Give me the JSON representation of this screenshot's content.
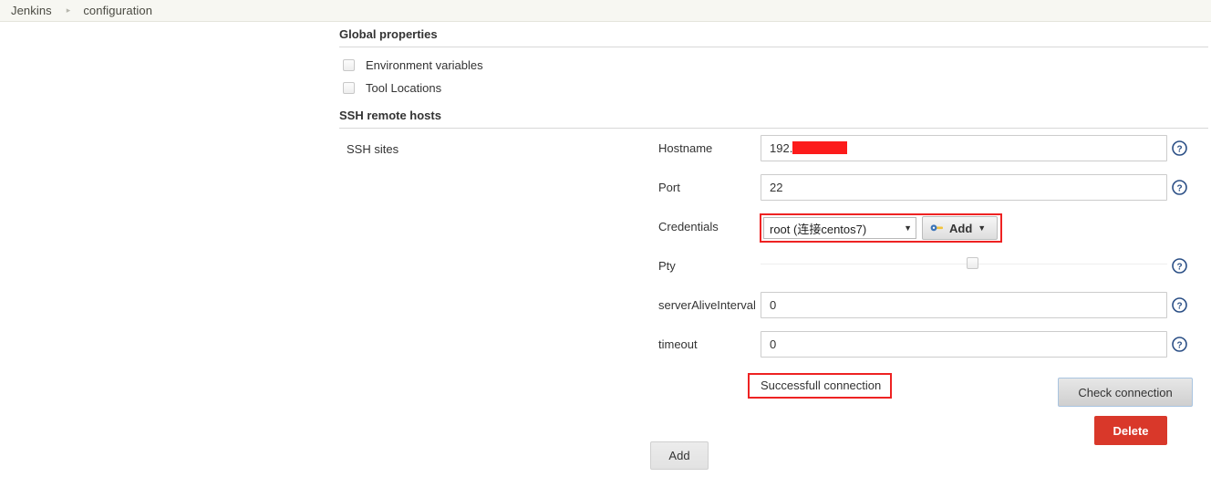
{
  "breadcrumb": {
    "root": "Jenkins",
    "separator": "▸",
    "current": "configuration"
  },
  "global_properties": {
    "title": "Global properties",
    "checkboxes": [
      {
        "label": "Environment variables",
        "checked": false
      },
      {
        "label": "Tool Locations",
        "checked": false
      }
    ]
  },
  "ssh_remote_hosts": {
    "title": "SSH remote hosts",
    "sites_label": "SSH sites",
    "fields": [
      {
        "label": "Hostname",
        "value": "192.",
        "redacted": true,
        "help": "help-icon"
      },
      {
        "label": "Port",
        "value": "22",
        "redacted": false,
        "help": "help-icon"
      },
      {
        "label": "serverAliveInterval",
        "value": "0",
        "redacted": false,
        "help": "help-icon"
      },
      {
        "label": "timeout",
        "value": "0",
        "redacted": false,
        "help": "help-icon"
      }
    ],
    "credentials": {
      "label": "Credentials",
      "selected": "root (连接centos7)",
      "caret": "▼",
      "add_button": "Add",
      "add_caret": "▼",
      "highlight_color": "#ee2222"
    },
    "pty": {
      "label": "Pty",
      "checked": false,
      "help": "help-icon"
    },
    "status": {
      "text": "Successfull connection",
      "highlight_color": "#ee2222"
    },
    "check_connection_button": "Check connection",
    "delete_button": "Delete",
    "delete_color": "#d9382a"
  },
  "footer": {
    "add_button": "Add"
  }
}
